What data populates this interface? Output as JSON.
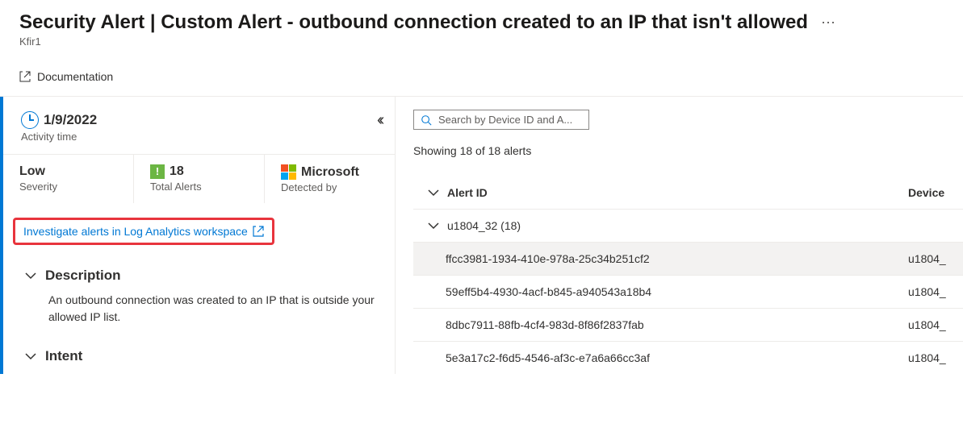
{
  "header": {
    "title": "Security Alert | Custom Alert - outbound connection created to an IP that isn't allowed",
    "subtitle": "Kfir1",
    "documentation_label": "Documentation"
  },
  "left_panel": {
    "time": {
      "value": "1/9/2022",
      "label": "Activity time"
    },
    "metrics": {
      "severity": {
        "value": "Low",
        "label": "Severity"
      },
      "total_alerts": {
        "value": "18",
        "label": "Total Alerts"
      },
      "detected_by": {
        "value": "Microsoft",
        "label": "Detected by"
      }
    },
    "investigate_link": "Investigate alerts in Log Analytics workspace",
    "description": {
      "title": "Description",
      "body": "An outbound connection was created to an IP that is outside your allowed IP list."
    },
    "intent": {
      "title": "Intent"
    }
  },
  "right_panel": {
    "search_placeholder": "Search by Device ID and A...",
    "showing": "Showing 18 of 18 alerts",
    "columns": {
      "alert_id": "Alert ID",
      "device": "Device "
    },
    "group": {
      "label": "u1804_32 (18)"
    },
    "rows": [
      {
        "id": "ffcc3981-1934-410e-978a-25c34b251cf2",
        "device": "u1804_"
      },
      {
        "id": "59eff5b4-4930-4acf-b845-a940543a18b4",
        "device": "u1804_"
      },
      {
        "id": "8dbc7911-88fb-4cf4-983d-8f86f2837fab",
        "device": "u1804_"
      },
      {
        "id": "5e3a17c2-f6d5-4546-af3c-e7a6a66cc3af",
        "device": "u1804_"
      }
    ]
  }
}
